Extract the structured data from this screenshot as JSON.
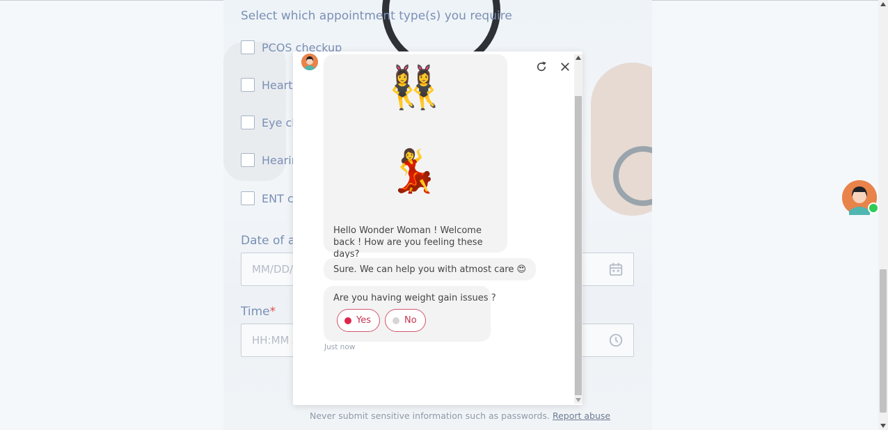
{
  "form": {
    "section_title": "Select which appointment type(s) you require",
    "appointment_options": [
      "PCOS checkup",
      "Heart",
      "Eye ch",
      "Hearin",
      "ENT c"
    ],
    "date_label": "Date of ap",
    "date_placeholder": "MM/DD/",
    "time_label": "Time",
    "time_required_mark": "*",
    "time_placeholder": "HH:MM A"
  },
  "footer": {
    "note": "Never submit sensitive information such as passwords.",
    "report_link": "Report abuse"
  },
  "chat": {
    "emoji_top": "👯‍♀️",
    "emoji_bottom": "💃",
    "greeting": "Hello Wonder Woman ! Welcome back ! How are you feeling these days?",
    "reply": "Sure. We can help you with atmost care 😍",
    "question": "Are you having weight gain issues ?",
    "options": [
      {
        "label": "Yes",
        "selected": true
      },
      {
        "label": "No",
        "selected": false
      }
    ],
    "timestamp": "Just now"
  },
  "colors": {
    "accent": "#d1566b",
    "selected_dot": "#e0244b",
    "online": "#2ecc57",
    "label": "#7a8fb5"
  },
  "icons": [
    "calendar-icon",
    "clock-icon",
    "refresh-icon",
    "close-icon",
    "avatar"
  ]
}
